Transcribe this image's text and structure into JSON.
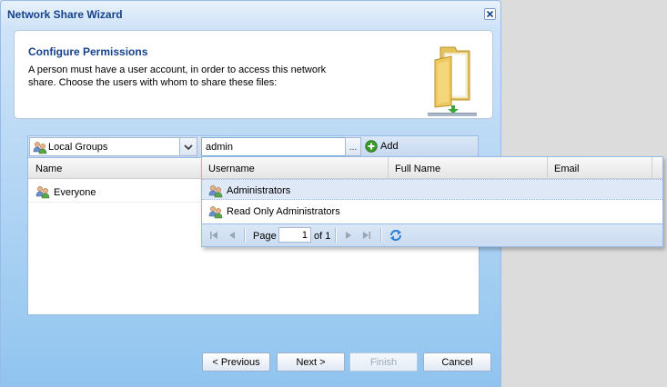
{
  "window": {
    "title": "Network Share Wizard"
  },
  "header": {
    "title": "Configure Permissions",
    "description": "A person must have a user account, in order to access this network share. Choose the users with whom to share these files:"
  },
  "toolbar": {
    "group_combo_value": "Local Groups",
    "search_value": "admin",
    "browse_label": "...",
    "add_label": "Add"
  },
  "grid": {
    "column": "Name",
    "rows": [
      {
        "name": "Everyone"
      }
    ]
  },
  "dropdown": {
    "columns": [
      "Username",
      "Full Name",
      "Email"
    ],
    "rows": [
      {
        "username": "Administrators",
        "full_name": "",
        "email": "",
        "selected": true
      },
      {
        "username": "Read Only Administrators",
        "full_name": "",
        "email": "",
        "selected": false
      }
    ],
    "pager": {
      "page_label": "Page",
      "page_value": "1",
      "of_label": "of 1"
    }
  },
  "footer": {
    "previous_label": "< Previous",
    "next_label": "Next >",
    "finish_label": "Finish",
    "cancel_label": "Cancel"
  },
  "colors": {
    "title_text": "#15428b",
    "add_icon": "#3a9a2a",
    "selected_row": "#dfe8f6"
  }
}
